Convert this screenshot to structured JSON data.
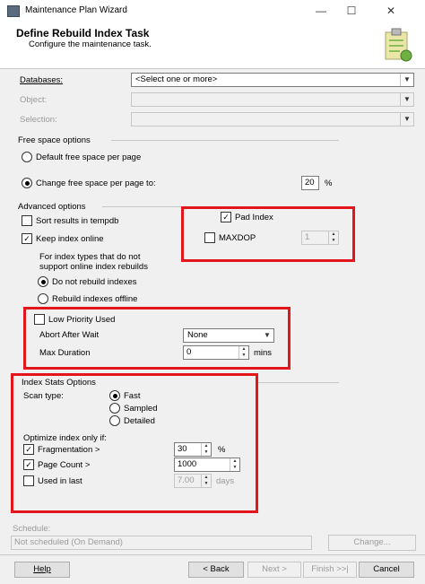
{
  "window": {
    "title": "Maintenance Plan Wizard",
    "min": "—",
    "max": "☐",
    "close": "✕"
  },
  "header": {
    "title": "Define Rebuild Index Task",
    "subtitle": "Configure the maintenance task."
  },
  "fields": {
    "databases_label": "Databases:",
    "databases_value": "<Select one or more>",
    "object_label": "Object:",
    "selection_label": "Selection:"
  },
  "free_space": {
    "heading": "Free space options",
    "default_label": "Default free space per page",
    "change_label": "Change free space per page to:",
    "change_value": "20",
    "unit": "%"
  },
  "advanced": {
    "heading": "Advanced options",
    "sort_label": "Sort results in tempdb",
    "keep_online_label": "Keep index online",
    "pad_index_label": "Pad Index",
    "maxdop_label": "MAXDOP",
    "maxdop_value": "1",
    "note_line1": "For index types that do not",
    "note_line2": "support online index rebuilds",
    "do_not_rebuild_label": "Do not rebuild indexes",
    "rebuild_offline_label": "Rebuild indexes offline"
  },
  "low_priority": {
    "label": "Low Priority Used",
    "abort_label": "Abort After Wait",
    "abort_value": "None",
    "max_duration_label": "Max Duration",
    "max_duration_value": "0",
    "mins": "mins"
  },
  "index_stats": {
    "heading": "Index Stats Options",
    "scan_type_label": "Scan type:",
    "fast": "Fast",
    "sampled": "Sampled",
    "detailed": "Detailed",
    "optimize_label": "Optimize index only if:",
    "fragmentation_label": "Fragmentation >",
    "fragmentation_value": "30",
    "fragmentation_unit": "%",
    "page_count_label": "Page Count >",
    "page_count_value": "1000",
    "used_label": "Used  in last",
    "used_value": "7.00",
    "used_unit": "days"
  },
  "schedule": {
    "label": "Schedule:",
    "value": "Not scheduled (On Demand)",
    "change_button": "Change..."
  },
  "footer": {
    "help": "Help",
    "back": "< Back",
    "next": "Next >",
    "finish": "Finish >>|",
    "cancel": "Cancel"
  },
  "colors": {
    "highlight": "#e3161b"
  }
}
